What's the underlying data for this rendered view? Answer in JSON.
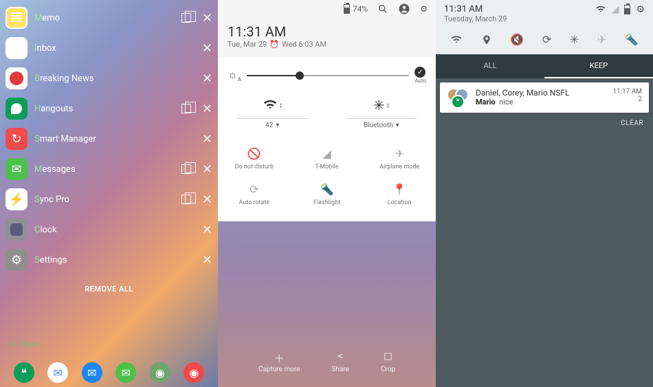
{
  "screen1": {
    "apps": [
      {
        "name": "Memo",
        "iconClass": "ic-memo",
        "hasDual": true
      },
      {
        "name": "Inbox",
        "iconClass": "ic-inbox",
        "hasDual": false
      },
      {
        "name": "Breaking News",
        "iconClass": "ic-news",
        "hasDual": false
      },
      {
        "name": "Hangouts",
        "iconClass": "ic-hangouts",
        "hasDual": true
      },
      {
        "name": "Smart Manager",
        "iconClass": "ic-smart",
        "hasDual": false
      },
      {
        "name": "Messages",
        "iconClass": "ic-msgs",
        "hasDual": true
      },
      {
        "name": "Sync Pro",
        "iconClass": "ic-sync",
        "hasDual": true
      },
      {
        "name": "Clock",
        "iconClass": "ic-clock",
        "hasDual": false
      },
      {
        "name": "Settings",
        "iconClass": "ic-settings",
        "hasDual": false
      }
    ],
    "removeAll": "REMOVE ALL",
    "work": "Work"
  },
  "screen2": {
    "battery": "74%",
    "time": "11:31 AM",
    "date": "Tue, Mar 29",
    "alarm": "Wed 6:03 AM",
    "autoLabel": "Auto",
    "wifi": {
      "value": "42"
    },
    "bt": {
      "value": "Bluetooth"
    },
    "tiles": [
      {
        "label": "Do not disturb"
      },
      {
        "label": "T-Mobile"
      },
      {
        "label": "Airplane mode"
      },
      {
        "label": "Auto rotate"
      },
      {
        "label": "Flashlight"
      },
      {
        "label": "Location"
      }
    ],
    "actions": {
      "capture": "Capture more",
      "share": "Share",
      "crop": "Crop"
    }
  },
  "screen3": {
    "time": "11:31 AM",
    "date": "Tuesday, March 29",
    "tabs": {
      "all": "ALL",
      "keep": "KEEP"
    },
    "notif": {
      "title": "Daniel, Corey, Mario NSFL",
      "sender": "Mario",
      "msg": "nice",
      "time": "11:17 AM",
      "count": "2"
    },
    "clear": "CLEAR"
  }
}
